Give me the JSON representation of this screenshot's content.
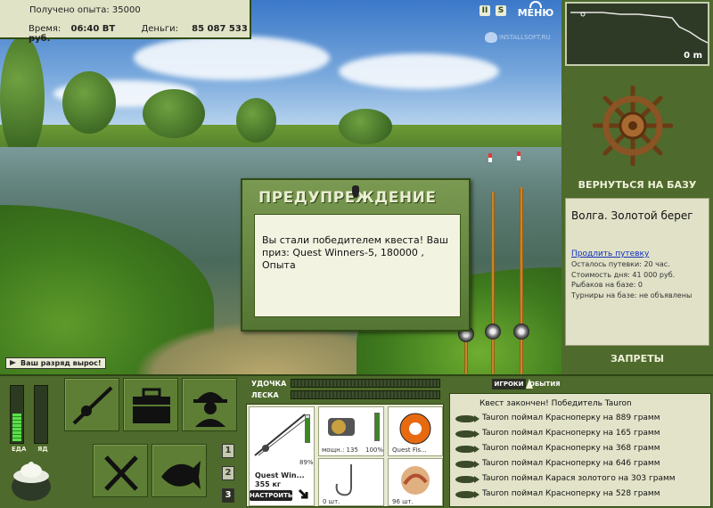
{
  "header": {
    "experience_label": "Получено опыта:",
    "experience_value": "35000",
    "time_label": "Время:",
    "time_value": "06:40 ВТ",
    "money_label": "Деньги:",
    "money_value": "85 087 533 руб."
  },
  "top_controls": {
    "pause_label": "II",
    "sound_label": "S",
    "menu_label": "МЕНЮ"
  },
  "watermark": "INSTALLSOFT.RU",
  "dialog": {
    "title": "ПРЕДУПРЕЖДЕНИЕ",
    "message": "Вы стали победителем квеста! Ваш приз: Quest Winners-5, 180000 , Опыта"
  },
  "toast": "Ваш разряд вырос!",
  "minimap": {
    "depth_label": "0 m"
  },
  "side": {
    "back_to_base": "ВЕРНУТЬСЯ НА БАЗУ",
    "location_name": "Волга. Золотой берег",
    "extend_trip_link": "Продлить путевку",
    "stats": [
      "Осталось путевки: 20 час.",
      "Стоимость дня: 41 000 руб.",
      "Рыбаков на базе: 0",
      "Турниры на базе: не объявлены"
    ],
    "bans": "ЗАПРЕТЫ"
  },
  "needs": {
    "food_label": "ЕДА",
    "poison_label": "ЯД",
    "food_level": 0.5,
    "poison_level": 0.0
  },
  "num_buttons": [
    "1",
    "2",
    "3"
  ],
  "tackle": {
    "rod_label": "УДОЧКА",
    "line_label": "ЛЕСКА",
    "rod_name": "Quest Win...",
    "rod_weight": "355 кг",
    "rod_percent": "89%",
    "reel_caption": "мощн.: 135",
    "reel_percent": "100%",
    "line_caption": "Quest Fis...",
    "hook_caption": "0 шт.",
    "bait_caption": "96 шт.",
    "setup_button": "НАСТРОИТЬ"
  },
  "events": {
    "tab_players": "ИГРОКИ",
    "tab_events": "ОБЫТИЯ",
    "headline": "Квест закончен! Победитель Tauron",
    "items": [
      "Tauron поймал Красноперку на 889 грамм",
      "Tauron поймал Красноперку на 165 грамм",
      "Tauron поймал Красноперку на 368 грамм",
      "Tauron поймал Красноперку на 646 грамм",
      "Tauron поймал Карася золотого на 303 грамм",
      "Tauron поймал Красноперку на 528 грамм"
    ]
  },
  "colors": {
    "panel_green": "#4e6a2c",
    "panel_light": "#e0e1c7",
    "gauge_green": "#5ae04a",
    "link_blue": "#1030c0"
  }
}
